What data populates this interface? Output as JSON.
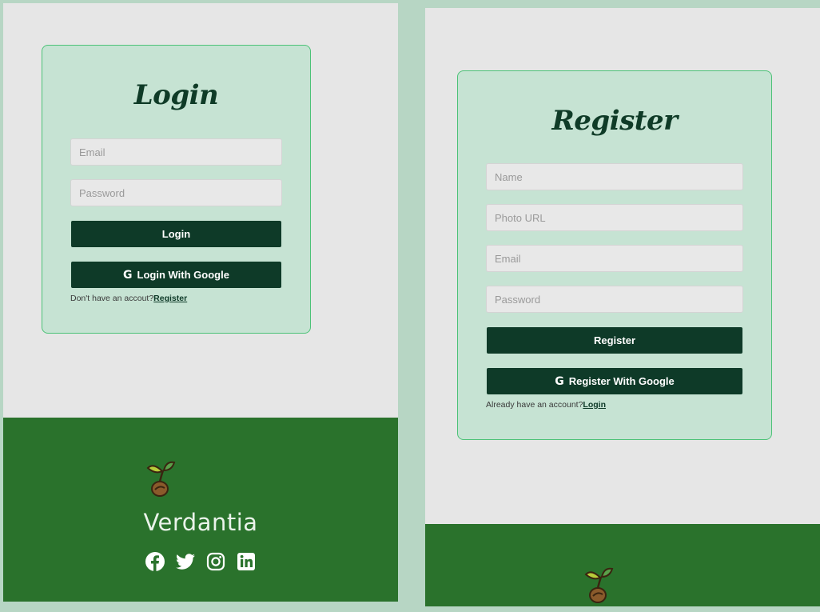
{
  "login": {
    "title": "Login",
    "email_placeholder": "Email",
    "password_placeholder": "Password",
    "submit_label": "Login",
    "google_label": "Login With Google",
    "switch_prompt": "Don't have an accout?",
    "switch_link": "Register"
  },
  "register": {
    "title": "Register",
    "name_placeholder": "Name",
    "photo_placeholder": "Photo URL",
    "email_placeholder": "Email",
    "password_placeholder": "Password",
    "submit_label": "Register",
    "google_label": "Register With Google",
    "switch_prompt": "Already have an account?",
    "switch_link": "Login"
  },
  "footer": {
    "brand": "Verdantia",
    "social": [
      "facebook-icon",
      "twitter-icon",
      "instagram-icon",
      "linkedin-icon"
    ]
  },
  "colors": {
    "page_bg": "#b7d6c4",
    "panel_bg": "#e6e6e6",
    "card_bg": "#c6e3d3",
    "card_border": "#4cc277",
    "button_bg": "#0e3a28",
    "title_color": "#0f3b27",
    "footer_bg": "#2a722c"
  }
}
